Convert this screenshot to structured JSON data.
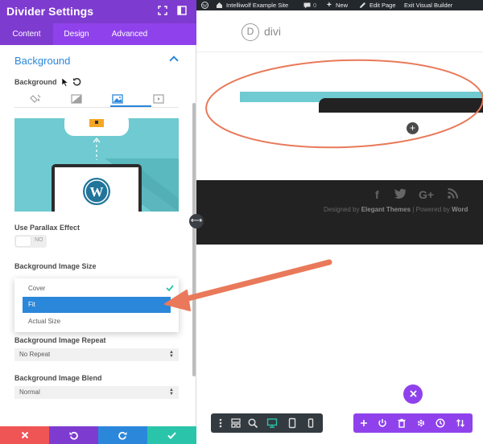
{
  "panel": {
    "title": "Divider Settings",
    "tabs": [
      "Content",
      "Design",
      "Advanced"
    ],
    "section_title": "Background",
    "background_label": "Background",
    "parallax_label": "Use Parallax Effect",
    "parallax_toggle": "NO",
    "size_label": "Background Image Size",
    "size_options": [
      "Cover",
      "Fit",
      "Actual Size"
    ],
    "size_selected": "Fit",
    "repeat_label": "Background Image Repeat",
    "repeat_value": "No Repeat",
    "blend_label": "Background Image Blend",
    "blend_value": "Normal",
    "colors": {
      "header": "#7e3bd0",
      "tabs": "#8f42ec",
      "accent": "#2b87da",
      "discard": "#ef5555",
      "undo": "#7e3bd0",
      "redo": "#2b87da",
      "save": "#29c4a9"
    }
  },
  "admin_bar": {
    "site_name": "Intelliwolf Example Site",
    "comments_count": "0",
    "new_label": "New",
    "edit_label": "Edit Page",
    "exit_label": "Exit Visual Builder"
  },
  "site": {
    "logo_letter": "D",
    "logo_text": "divi"
  },
  "footer": {
    "credit_prefix": "Designed by",
    "credit_brand": "Elegant Themes",
    "credit_suffix": "| Powered by",
    "credit_wp": "Word"
  }
}
